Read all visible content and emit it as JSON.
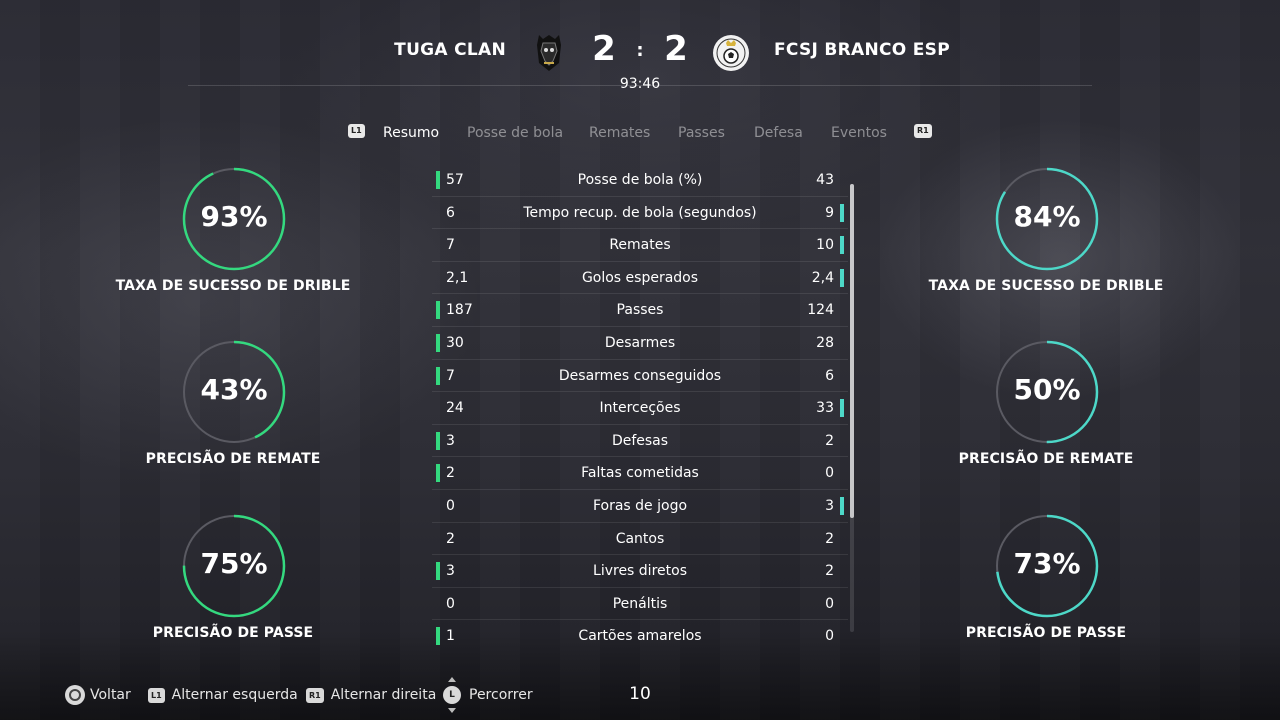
{
  "match": {
    "home_team": "TUGA CLAN",
    "away_team": "FCSJ BRANCO ESP",
    "home_score": "2",
    "away_score": "2",
    "separator": ":",
    "time": "93:46"
  },
  "tabs": {
    "left_button": "L1",
    "right_button": "R1",
    "items": [
      {
        "label": "Resumo",
        "active": true
      },
      {
        "label": "Posse de bola",
        "active": false
      },
      {
        "label": "Remates",
        "active": false
      },
      {
        "label": "Passes",
        "active": false
      },
      {
        "label": "Defesa",
        "active": false
      },
      {
        "label": "Eventos",
        "active": false
      }
    ]
  },
  "home_rings": [
    {
      "value": "93%",
      "fraction": 0.93,
      "label": "TAXA DE SUCESSO DE DRIBLE"
    },
    {
      "value": "43%",
      "fraction": 0.43,
      "label": "PRECISÃO DE REMATE"
    },
    {
      "value": "75%",
      "fraction": 0.75,
      "label": "PRECISÃO DE PASSE"
    }
  ],
  "away_rings": [
    {
      "value": "84%",
      "fraction": 0.84,
      "label": "TAXA DE SUCESSO DE DRIBLE"
    },
    {
      "value": "50%",
      "fraction": 0.5,
      "label": "PRECISÃO DE REMATE"
    },
    {
      "value": "73%",
      "fraction": 0.73,
      "label": "PRECISÃO DE PASSE"
    }
  ],
  "colors": {
    "home_accent": "#34d97f",
    "away_accent": "#4dd8c8",
    "ring_track": "#5a5a62"
  },
  "stats": [
    {
      "home": "57",
      "name": "Posse de bola (%)",
      "away": "43",
      "leader": "home"
    },
    {
      "home": "6",
      "name": "Tempo recup. de bola (segundos)",
      "away": "9",
      "leader": "away"
    },
    {
      "home": "7",
      "name": "Remates",
      "away": "10",
      "leader": "away"
    },
    {
      "home": "2,1",
      "name": "Golos esperados",
      "away": "2,4",
      "leader": "away"
    },
    {
      "home": "187",
      "name": "Passes",
      "away": "124",
      "leader": "home"
    },
    {
      "home": "30",
      "name": "Desarmes",
      "away": "28",
      "leader": "home"
    },
    {
      "home": "7",
      "name": "Desarmes conseguidos",
      "away": "6",
      "leader": "home"
    },
    {
      "home": "24",
      "name": "Interceções",
      "away": "33",
      "leader": "away"
    },
    {
      "home": "3",
      "name": "Defesas",
      "away": "2",
      "leader": "home"
    },
    {
      "home": "2",
      "name": "Faltas cometidas",
      "away": "0",
      "leader": "home"
    },
    {
      "home": "0",
      "name": "Foras de jogo",
      "away": "3",
      "leader": "away"
    },
    {
      "home": "2",
      "name": "Cantos",
      "away": "2",
      "leader": "none"
    },
    {
      "home": "3",
      "name": "Livres diretos",
      "away": "2",
      "leader": "home"
    },
    {
      "home": "0",
      "name": "Penáltis",
      "away": "0",
      "leader": "none"
    },
    {
      "home": "1",
      "name": "Cartões amarelos",
      "away": "0",
      "leader": "home"
    }
  ],
  "footer": {
    "back_label": "Voltar",
    "l1_tag": "L1",
    "l1_label": "Alternar esquerda",
    "r1_tag": "R1",
    "r1_label": "Alternar direita",
    "stick_tag": "L",
    "stick_label": "Percorrer",
    "page_number": "10"
  }
}
